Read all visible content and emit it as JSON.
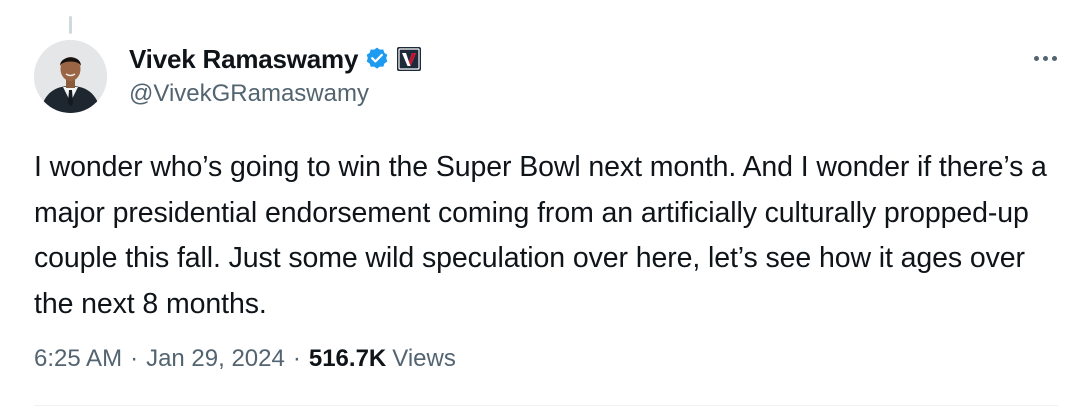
{
  "author": {
    "name": "Vivek Ramaswamy",
    "handle": "@VivekGRamaswamy",
    "verified": true,
    "avatar": "profile-photo",
    "affiliate_badge": "v-logo-badge"
  },
  "tweet": {
    "text": "I wonder who’s going to win the Super Bowl next month. And I wonder if there’s a major presidential endorsement coming from an artificially culturally propped-up couple this fall. Just some wild speculation over here, let’s see how it ages over the next 8 months."
  },
  "meta": {
    "time": "6:25 AM",
    "separator": "·",
    "date": "Jan 29, 2024",
    "views_count": "516.7K",
    "views_label": "Views"
  },
  "icons": {
    "more": "more-horizontal-icon",
    "verified": "verified-badge-icon"
  },
  "colors": {
    "text": "#0f1419",
    "secondary": "#536471",
    "verified_blue": "#1d9bf0",
    "badge_dark": "#1c2a3a",
    "badge_red": "#c8102e"
  }
}
